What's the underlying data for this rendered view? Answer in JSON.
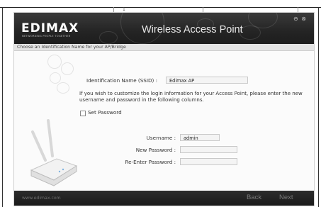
{
  "window": {
    "logo_text": "EDIMAX",
    "tagline": "NETWORKING PEOPLE TOGETHER",
    "product_title": "Wireless Access Point",
    "controls": "⊖ ⊗"
  },
  "subheader": {
    "title": "Choose an Identification Name for your AP/Bridge"
  },
  "form": {
    "ssid_label": "Identification Name (SSID) :",
    "ssid_value": "Edimax AP",
    "description": "If you wish to customize the login information for your Access Point, please enter the new username and password in the following columns.",
    "set_password_label": "Set Password",
    "set_password_checked": false,
    "username_label": "Username :",
    "username_value": "admin",
    "new_password_label": "New Password :",
    "new_password_value": "",
    "reenter_password_label": "Re-Enter Password :",
    "reenter_password_value": ""
  },
  "footer": {
    "url": "www.edimax.com",
    "back_label": "Back",
    "next_label": "Next"
  },
  "page_fragment": {
    "mark": "1"
  }
}
